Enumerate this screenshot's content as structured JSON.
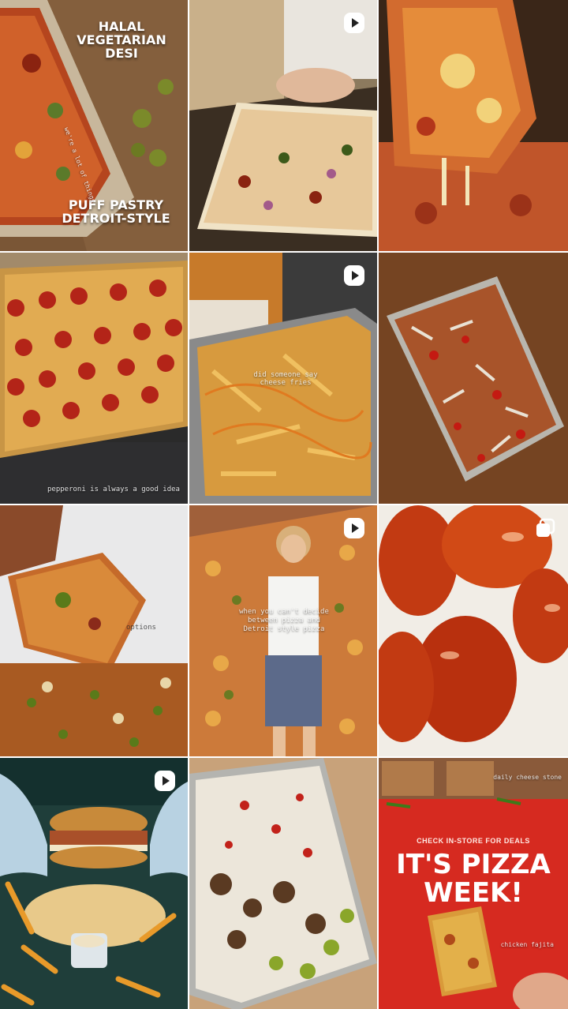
{
  "feed": {
    "tiles": [
      {
        "kind": "image",
        "overlay_line1": "HALAL",
        "overlay_line2": "VEGETARIAN",
        "overlay_line3": "DESI",
        "overlay_bottom1": "PUFF PASTRY",
        "overlay_bottom2": "DETROIT-STYLE",
        "side_caption": "we're a lot of things"
      },
      {
        "kind": "reel",
        "badge_icon": "reel-play-icon"
      },
      {
        "kind": "image"
      },
      {
        "kind": "image",
        "caption": "pepperoni is always a good idea"
      },
      {
        "kind": "reel",
        "badge_icon": "reel-play-icon",
        "caption": "did someone say cheese fries"
      },
      {
        "kind": "image"
      },
      {
        "kind": "image",
        "caption": "options"
      },
      {
        "kind": "reel",
        "badge_icon": "reel-play-icon",
        "caption": "when you can't decide between pizza and Detroit style pizza"
      },
      {
        "kind": "carousel",
        "badge_icon": "carousel-icon"
      },
      {
        "kind": "reel",
        "badge_icon": "reel-play-icon"
      },
      {
        "kind": "image"
      },
      {
        "kind": "image",
        "top_caption": "daily cheese stone",
        "promo_sub": "CHECK IN-STORE FOR DEALS",
        "promo_line1": "IT'S PIZZA",
        "promo_line2": "WEEK!",
        "side_caption": "chicken fajita"
      }
    ]
  },
  "colors": {
    "promo_red": "#d62a20",
    "badge_white": "#ffffff"
  }
}
